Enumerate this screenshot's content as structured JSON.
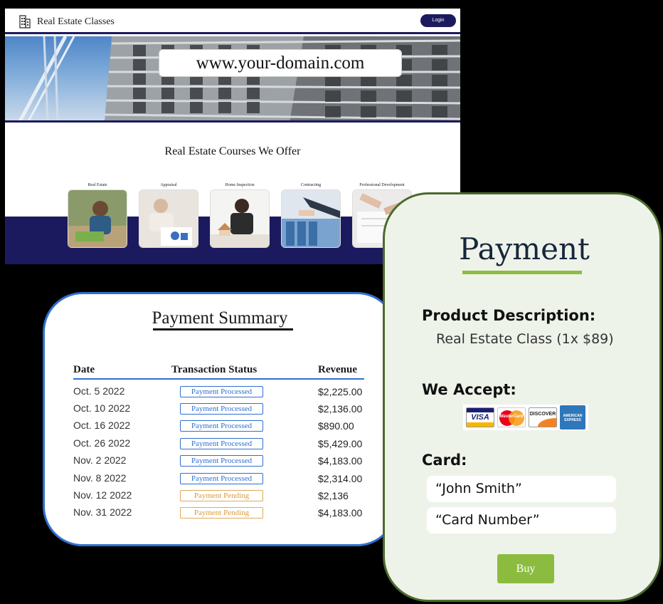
{
  "website": {
    "brand": "Real Estate Classes",
    "login_label": "Login",
    "url": "www.your-domain.com",
    "courses_title": "Real Estate Courses We Offer",
    "courses": [
      {
        "label": "Real Estate"
      },
      {
        "label": "Appraisal"
      },
      {
        "label": "Home Inspection"
      },
      {
        "label": "Contracting"
      },
      {
        "label": "Professional Development"
      }
    ],
    "accent_color": "#1c1a5e"
  },
  "summary": {
    "title": "Payment Summary",
    "columns": {
      "date": "Date",
      "status": "Transaction Status",
      "revenue": "Revenue"
    },
    "rows": [
      {
        "date": "Oct. 5 2022",
        "status": "Payment Processed",
        "revenue": "$2,225.00"
      },
      {
        "date": "Oct. 10 2022",
        "status": "Payment Processed",
        "revenue": "$2,136.00"
      },
      {
        "date": "Oct. 16 2022",
        "status": "Payment Processed",
        "revenue": "$890.00"
      },
      {
        "date": "Oct. 26 2022",
        "status": "Payment Processed",
        "revenue": "$5,429.00"
      },
      {
        "date": "Nov. 2 2022",
        "status": "Payment Processed",
        "revenue": "$4,183.00"
      },
      {
        "date": "Nov. 8 2022",
        "status": "Payment Processed",
        "revenue": "$2,314.00"
      },
      {
        "date": "Nov. 12 2022",
        "status": "Payment Pending",
        "revenue": "$2,136"
      },
      {
        "date": "Nov. 31 2022",
        "status": "Payment Pending",
        "revenue": "$4,183.00"
      }
    ],
    "border_color": "#2f6fd0",
    "pending_color": "#e0a85a"
  },
  "payment": {
    "title": "Payment",
    "product_label": "Product Description:",
    "product_value": "Real Estate Class (1x $89)",
    "accept_label": "We Accept:",
    "card_logos": {
      "visa": "VISA",
      "mastercard": "MasterCard",
      "discover": "DISCOVER",
      "amex": "AMERICAN EXPRESS"
    },
    "card_label": "Card:",
    "name_value": "“John Smith”",
    "number_value": "“Card Number”",
    "buy_label": "Buy",
    "accent_color": "#8cbc3f",
    "border_color": "#4a6b2c"
  }
}
